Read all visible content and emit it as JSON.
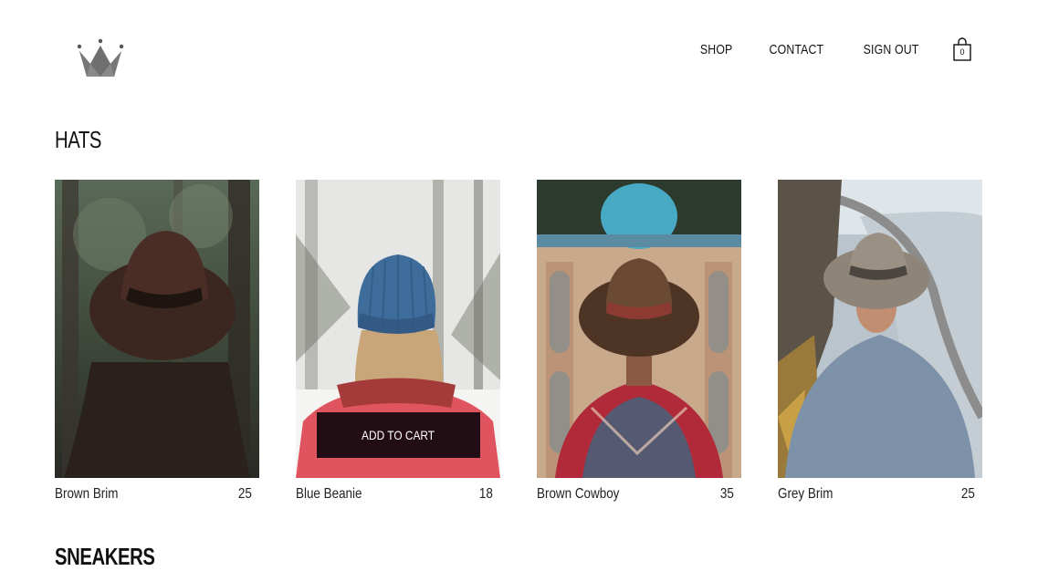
{
  "brand": {
    "logo_icon": "crown-icon"
  },
  "nav": {
    "items": [
      {
        "label": "SHOP"
      },
      {
        "label": "CONTACT"
      },
      {
        "label": "SIGN OUT"
      }
    ],
    "cart": {
      "icon": "shopping-bag-icon",
      "count": "0"
    }
  },
  "sections": [
    {
      "title": "HATS",
      "products": [
        {
          "name": "Brown Brim",
          "price": "25"
        },
        {
          "name": "Blue Beanie",
          "price": "18",
          "hover_button": "ADD TO CART"
        },
        {
          "name": "Brown Cowboy",
          "price": "35"
        },
        {
          "name": "Grey Brim",
          "price": "25"
        }
      ]
    },
    {
      "title": "SNEAKERS"
    }
  ],
  "colors": {
    "button_bg": "#14080e",
    "text": "#111111",
    "background": "#ffffff"
  }
}
